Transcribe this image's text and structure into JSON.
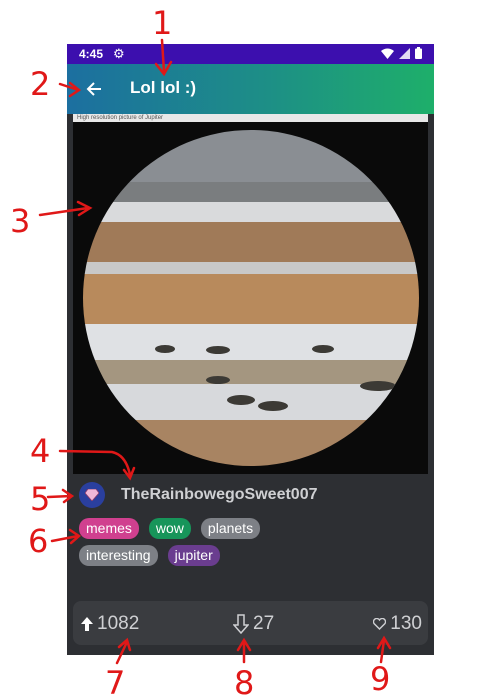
{
  "status_bar": {
    "time": "4:45",
    "icons": [
      "gear-icon",
      "wifi-icon",
      "signal-icon",
      "battery-icon"
    ]
  },
  "toolbar": {
    "title": "Lol lol :)",
    "back_icon": "back-arrow-icon"
  },
  "post": {
    "caption_snippet": "High resolution picture of Jupiter",
    "author": {
      "name": "TheRainbowegoSweet007",
      "avatar_icon": "gem-icon"
    },
    "tags": [
      {
        "label": "memes",
        "color": "#d0408f"
      },
      {
        "label": "wow",
        "color": "#17955a"
      },
      {
        "label": "planets",
        "color": "#7d8086"
      },
      {
        "label": "interesting",
        "color": "#7d8086"
      },
      {
        "label": "jupiter",
        "color": "#6a3d8f"
      }
    ],
    "stats": {
      "upvotes": "1082",
      "downvotes": "27",
      "favorites": "130"
    }
  },
  "annotations": [
    "1",
    "2",
    "3",
    "4",
    "5",
    "6",
    "7",
    "8",
    "9"
  ],
  "colors": {
    "status_bar": "#3c0fae",
    "toolbar_start": "#1c6fa0",
    "toolbar_end": "#1eaf6a",
    "background": "#2d2f33",
    "annotation": "#e01818"
  }
}
